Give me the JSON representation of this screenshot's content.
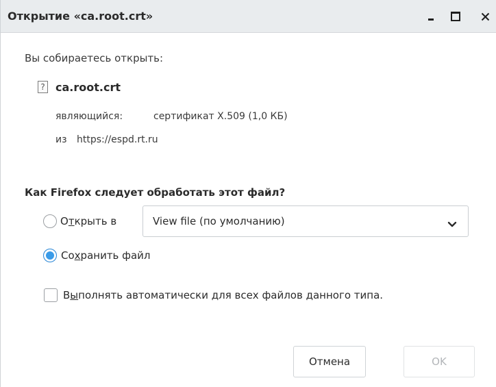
{
  "window": {
    "title": "Открытие «ca.root.crt»",
    "minimize_icon": "minimize-icon",
    "maximize_icon": "maximize-icon",
    "close_icon": "close-icon"
  },
  "dialog": {
    "prompt": "Вы собираетесь открыть:",
    "file_icon_glyph": "?",
    "file_name": "ca.root.crt",
    "type_label": "являющийся:",
    "type_value": "сертификат X.509 (1,0 КБ)",
    "from_label": "из",
    "from_url": "https://espd.rt.ru",
    "question": "Как Firefox следует обработать этот файл?"
  },
  "options": {
    "open_label_before": "О",
    "open_label_underlined": "т",
    "open_label_after": "крыть в",
    "open_selected": false,
    "open_with_value": "View file (по умолчанию)",
    "save_label_before": "Со",
    "save_label_underlined": "х",
    "save_label_after": "ранить файл",
    "save_selected": true,
    "auto_label_before": "В",
    "auto_label_underlined": "ы",
    "auto_label_after": "полнять автоматически для всех файлов данного типа.",
    "auto_checked": false
  },
  "buttons": {
    "cancel": "Отмена",
    "ok": "OK",
    "ok_enabled": false
  },
  "colors": {
    "accent": "#3a9be8",
    "titlebar_bg": "#e9ecee",
    "disabled_text": "#b3b6b9"
  }
}
